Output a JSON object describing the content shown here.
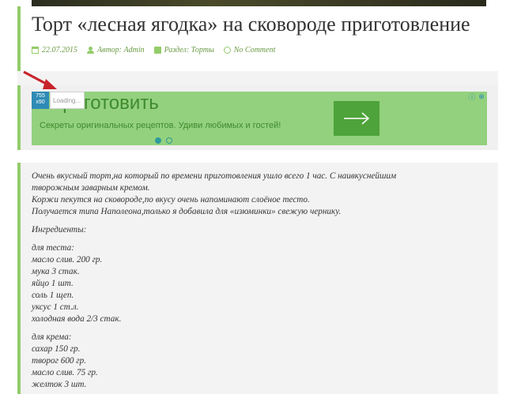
{
  "post": {
    "title": "Торт «лесная ягодка» на сковороде приготовление",
    "meta": {
      "date": "22.07.2015",
      "author": "Автор: Admin",
      "section": "Раздел: Торты",
      "comments": "No Comment"
    }
  },
  "ad": {
    "title": "Приготовить",
    "description": "Секреты оригинальных рецептов. Удиви любимых и гостей!",
    "size_badge": [
      "755",
      "x90"
    ],
    "loading_text": "Loading...",
    "choices_icons": [
      "info-icon",
      "close-icon"
    ],
    "slides": 2,
    "active_slide": 0
  },
  "content": {
    "intro_lines": [
      "Очень вкусный торт,на который по времени приготовления ушло всего 1 час. С наивкуснейшим",
      "творожным заварным кремом.",
      "Коржи пекутся на сковороде,по вкусу очень напоминают слоёное тесто.",
      "Получается типа Наполеона,только я добавила для «изюминки» свежую чернику."
    ],
    "ingredients_heading": "Ингредиенты:",
    "dough_lines": [
      "для теста:",
      "масло слив. 200 гр.",
      "мука 3 стак.",
      "яйцо 1 шт.",
      "соль 1 щеп.",
      "уксус 1 ст.л.",
      "холодная вода 2/3 стак."
    ],
    "cream_lines": [
      "для крема:",
      "сахар 150 гр.",
      "творог 600 гр.",
      "масло слив. 75 гр.",
      "желток 3 шт."
    ]
  },
  "colors": {
    "accent": "#93cc6a",
    "ad_background": "#93d17e",
    "ad_text": "#3f8a2e",
    "ad_button": "#4ea33a",
    "arrow": "#c8242b"
  }
}
